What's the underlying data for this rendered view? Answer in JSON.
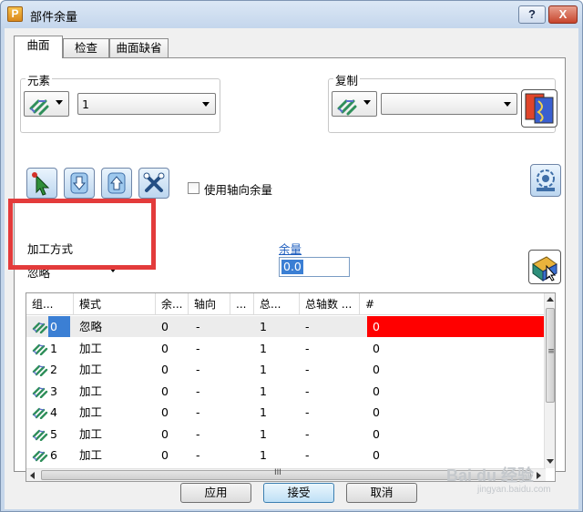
{
  "window": {
    "title": "部件余量",
    "app_icon_letter": "P",
    "help_label": "?",
    "close_label": "X"
  },
  "tabs": [
    {
      "label": "曲面",
      "active": true
    },
    {
      "label": "检查",
      "active": false
    },
    {
      "label": "曲面缺省",
      "active": false
    }
  ],
  "element_group": {
    "label": "元素",
    "value": "1"
  },
  "copy_group": {
    "label": "复制",
    "value": ""
  },
  "axial_checkbox": {
    "label": "使用轴向余量",
    "checked": false
  },
  "machining_group": {
    "label": "加工方式",
    "value": "忽略"
  },
  "allowance": {
    "label": "余量",
    "value": "0.0"
  },
  "table": {
    "headers": [
      "组...",
      "模式",
      "余...",
      "轴向",
      "...",
      "总...",
      "总轴数 ...",
      "#"
    ],
    "rows": [
      [
        "0",
        "忽略",
        "0",
        "-",
        "1",
        "-",
        "0"
      ],
      [
        "1",
        "加工",
        "0",
        "-",
        "1",
        "-",
        "0"
      ],
      [
        "2",
        "加工",
        "0",
        "-",
        "1",
        "-",
        "0"
      ],
      [
        "3",
        "加工",
        "0",
        "-",
        "1",
        "-",
        "0"
      ],
      [
        "4",
        "加工",
        "0",
        "-",
        "1",
        "-",
        "0"
      ],
      [
        "5",
        "加工",
        "0",
        "-",
        "1",
        "-",
        "0"
      ],
      [
        "6",
        "加工",
        "0",
        "-",
        "1",
        "-",
        "0"
      ]
    ],
    "hscroll_grip": "III",
    "vscroll_grip": "≡"
  },
  "buttons": {
    "apply": "应用",
    "accept": "接受",
    "cancel": "取消"
  },
  "watermark": {
    "brand": "Bai du 经验",
    "url": "jingyan.baidu.com"
  },
  "colors": {
    "highlight_red": "#ff0000",
    "selection_blue": "#3b7fd4",
    "box_red": "#e33b3b"
  }
}
